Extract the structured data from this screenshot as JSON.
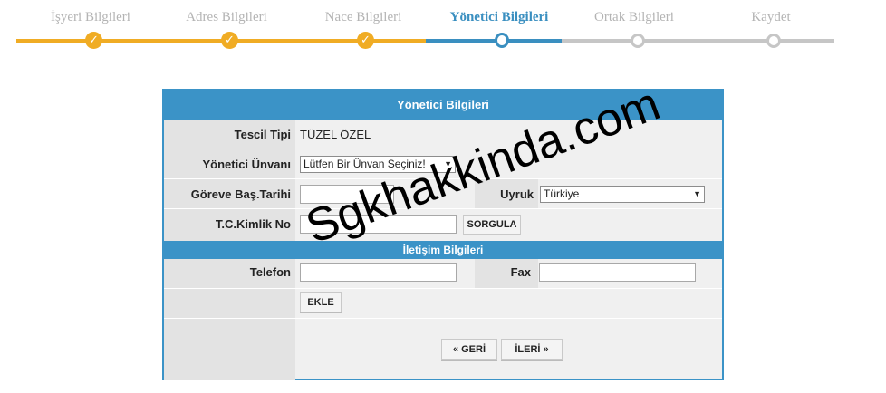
{
  "stepper": {
    "steps": [
      {
        "label": "İşyeri Bilgileri",
        "state": "done"
      },
      {
        "label": "Adres Bilgileri",
        "state": "done"
      },
      {
        "label": "Nace Bilgileri",
        "state": "done"
      },
      {
        "label": "Yönetici Bilgileri",
        "state": "current"
      },
      {
        "label": "Ortak Bilgileri",
        "state": "future"
      },
      {
        "label": "Kaydet",
        "state": "future"
      }
    ],
    "done_color": "#f0ac24",
    "current_color": "#3a8fc0",
    "future_color": "#c6c6c6"
  },
  "form": {
    "title": "Yönetici Bilgileri",
    "tescil_tipi": {
      "label": "Tescil Tipi",
      "value": "TÜZEL ÖZEL"
    },
    "yonetici_unvani": {
      "label": "Yönetici Ünvanı",
      "selected": "Lütfen Bir Ünvan Seçiniz!"
    },
    "goreve_bas_tarihi": {
      "label": "Göreve Baş.Tarihi",
      "value": ""
    },
    "uyruk": {
      "label": "Uyruk",
      "selected": "Türkiye"
    },
    "tc_kimlik": {
      "label": "T.C.Kimlik No",
      "value": "",
      "query_button": "SORGULA"
    },
    "iletisim_header": "İletişim Bilgileri",
    "telefon": {
      "label": "Telefon",
      "value": ""
    },
    "fax": {
      "label": "Fax",
      "value": ""
    },
    "add_button": "EKLE",
    "back_button": "« GERİ",
    "next_button": "İLERİ »"
  },
  "watermark": "Sgkhakkinda.com",
  "colors": {
    "accent": "#3b93c7",
    "label_bg": "#e3e3e3",
    "panel_bg": "#f0f0f0"
  }
}
